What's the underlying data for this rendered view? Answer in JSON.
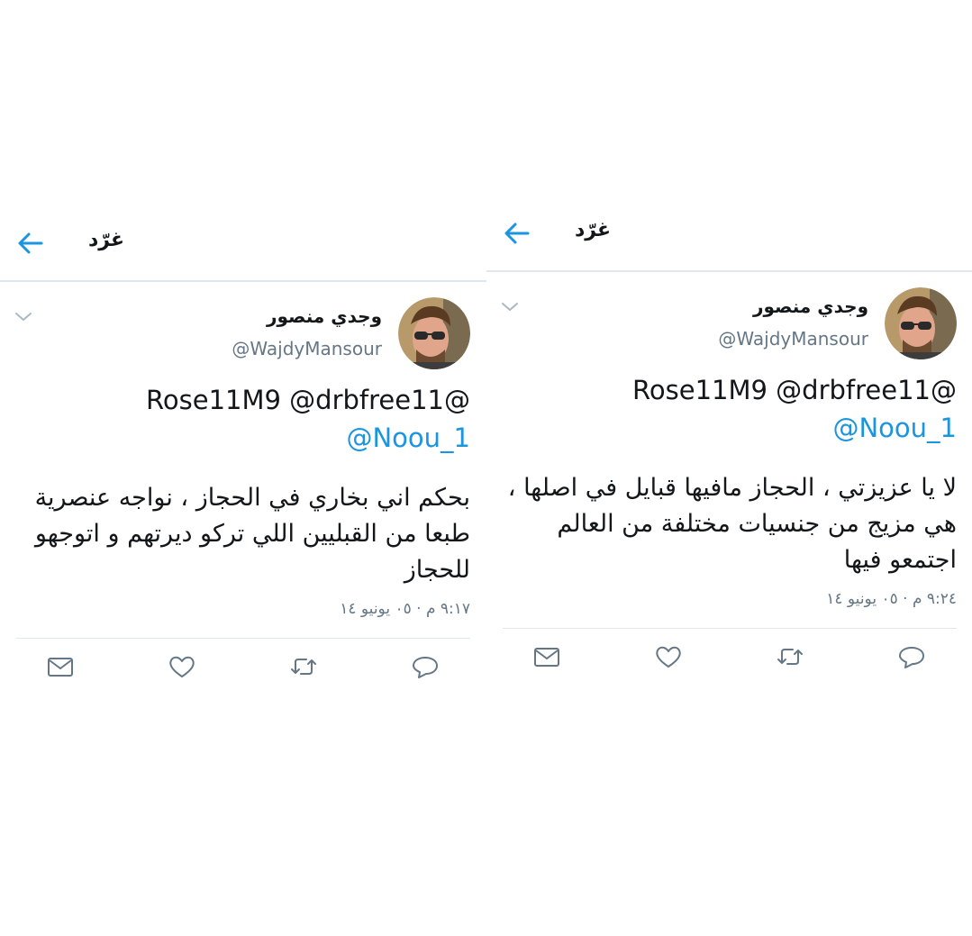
{
  "colors": {
    "accent": "#1b95e0",
    "text": "#14171a",
    "muted": "#657786",
    "divider": "#e1e8ed"
  },
  "icons": [
    "back-arrow-icon",
    "chevron-down-icon",
    "mail-icon",
    "heart-icon",
    "retweet-icon",
    "reply-icon"
  ],
  "panels": [
    {
      "header": {
        "title": "غرّد"
      },
      "tweet": {
        "author_name": "وجدي منصور",
        "author_handle": "@WajdyMansour",
        "mentions_line1": "Rose11M9 @drbfree11@",
        "mentions_line2": "@Noou_1",
        "text": "بحكم اني بخاري في الحجاز ، نواجه عنصرية طبعا من القبليين اللي تركو ديرتهم و اتوجهو للحجاز",
        "timestamp": "٩:١٧ م · ٠٥ يونيو ١٤"
      }
    },
    {
      "header": {
        "title": "غرّد"
      },
      "tweet": {
        "author_name": "وجدي منصور",
        "author_handle": "@WajdyMansour",
        "mentions_line1": "Rose11M9 @drbfree11@",
        "mentions_line2": "@Noou_1",
        "text": "لا يا عزيزتي ، الحجاز مافيها قبايل في اصلها ، هي مزيج من جنسيات مختلفة من العالم اجتمعو فيها",
        "timestamp": "٩:٢٤ م · ٠٥ يونيو ١٤"
      }
    }
  ]
}
